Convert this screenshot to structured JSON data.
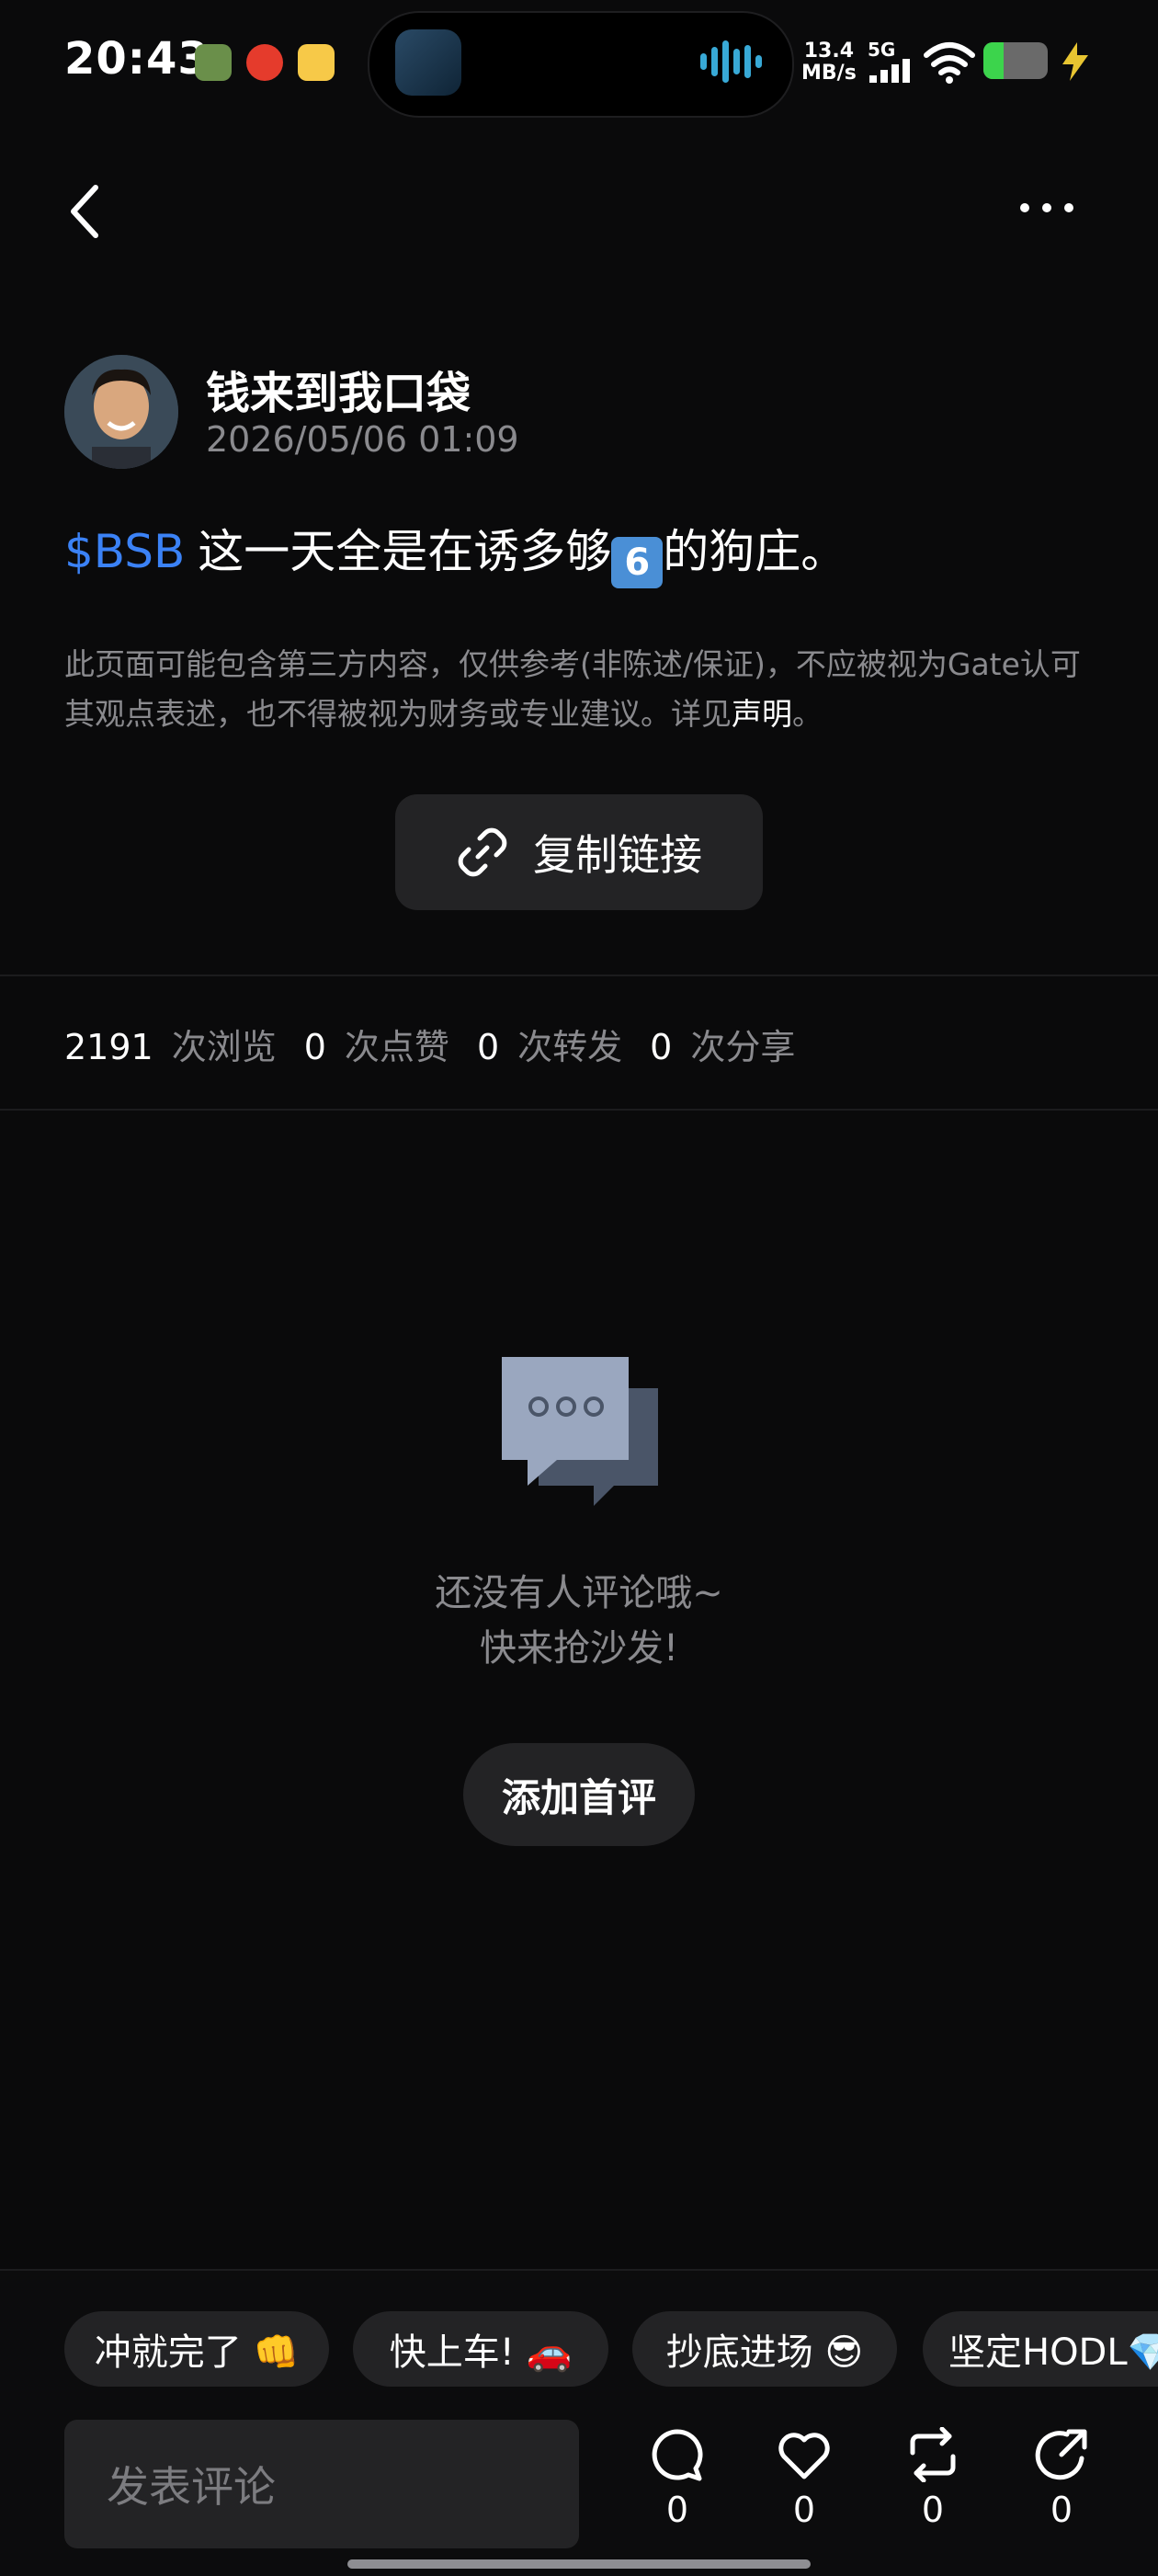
{
  "status_bar": {
    "time": "20:43",
    "network_speed_value": "13.4",
    "network_speed_unit": "MB/s",
    "network_type": "5G",
    "battery_level": 0.2
  },
  "header": {
    "back_icon": "chevron-left-icon",
    "more_icon": "more-horizontal-icon"
  },
  "post": {
    "author": "钱来到我口袋",
    "date": "2026/05/06 01:09",
    "ticker": "$BSB",
    "content_before": "这一天全是在诱多够",
    "emoji": "6",
    "content_after": "的狗庄。",
    "disclaimer": "此页面可能包含第三方内容，仅供参考(非陈述/保证)，不应被视为Gate认可其观点表述，也不得被视为财务或专业建议。详见",
    "disclaimer_link": "声明",
    "disclaimer_end": "。",
    "copy_link_label": "复制链接"
  },
  "stats": {
    "views": "2191",
    "views_label": "次浏览",
    "likes": "0",
    "likes_label": "次点赞",
    "reposts": "0",
    "reposts_label": "次转发",
    "shares": "0",
    "shares_label": "次分享"
  },
  "comments_empty": {
    "line1": "还没有人评论哦~",
    "line2": "快来抢沙发!",
    "add_first_label": "添加首评"
  },
  "quick_replies": [
    {
      "label": "冲就完了 👊"
    },
    {
      "label": "快上车! 🚗"
    },
    {
      "label": "抄底进场 😎"
    },
    {
      "label": "坚定HODL💎"
    }
  ],
  "bottom_bar": {
    "comment_placeholder": "发表评论",
    "comment_count": "0",
    "like_count": "0",
    "repost_count": "0",
    "share_count": "0"
  },
  "colors": {
    "background": "#0a0a0b",
    "accent_link": "#3b82f6",
    "muted_text": "#8a8a8e",
    "surface": "#232325"
  }
}
